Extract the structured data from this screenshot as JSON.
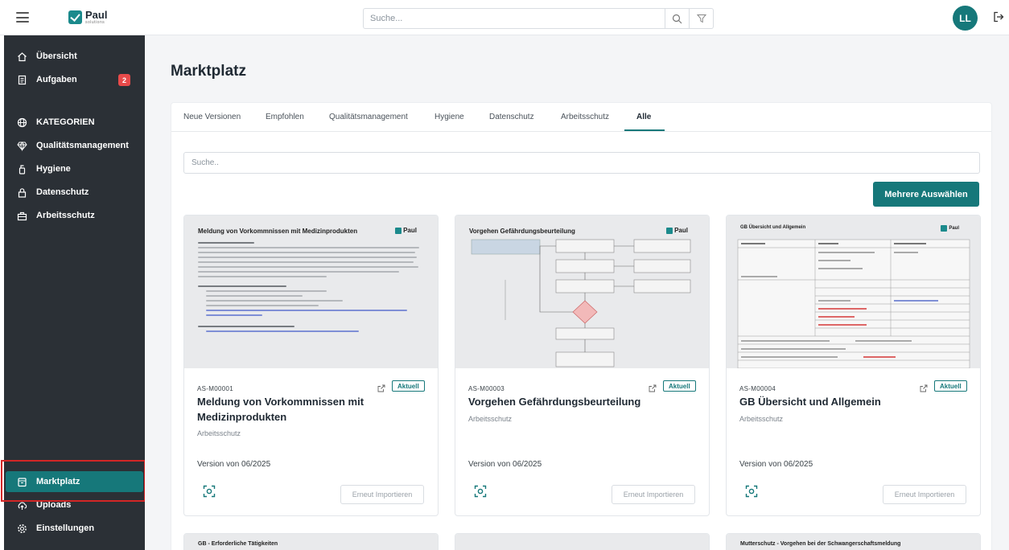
{
  "header": {
    "logo_name": "Paul",
    "logo_sub": "solutions",
    "search_placeholder": "Suche...",
    "user_initials": "LL"
  },
  "sidebar": {
    "items": [
      {
        "label": "Übersicht",
        "icon": "home-icon"
      },
      {
        "label": "Aufgaben",
        "icon": "clipboard-icon",
        "badge": "2"
      },
      {
        "label": "KATEGORIEN",
        "icon": "globe-icon"
      },
      {
        "label": "Qualitätsmanagement",
        "icon": "diamond-icon"
      },
      {
        "label": "Hygiene",
        "icon": "bottle-icon"
      },
      {
        "label": "Datenschutz",
        "icon": "lock-icon"
      },
      {
        "label": "Arbeitsschutz",
        "icon": "toolbox-icon"
      }
    ],
    "bottom_items": [
      {
        "label": "Marktplatz",
        "icon": "store-icon",
        "active": true
      },
      {
        "label": "Uploads",
        "icon": "upload-icon"
      },
      {
        "label": "Einstellungen",
        "icon": "gear-icon"
      }
    ],
    "colors": {
      "background": "#2b3036",
      "active": "#16787a",
      "highlight": "#d32626"
    }
  },
  "main": {
    "title": "Marktplatz",
    "tabs": [
      "Neue Versionen",
      "Empfohlen",
      "Qualitätsmanagement",
      "Hygiene",
      "Datenschutz",
      "Arbeitsschutz",
      "Alle"
    ],
    "active_tab": "Alle",
    "filter_placeholder": "Suche..",
    "multi_select_label": "Mehrere Auswählen",
    "cards": [
      {
        "code": "AS-M00001",
        "title": "Meldung von Vorkommnissen mit Medizinprodukten",
        "category": "Arbeitsschutz",
        "version": "Version von 06/2025",
        "status": "Aktuell",
        "import_label": "Erneut Importieren",
        "thumb_title": "Meldung von Vorkommnissen mit Medizinprodukten",
        "thumb_logo": "Paul"
      },
      {
        "code": "AS-M00003",
        "title": "Vorgehen Gefährdungsbeurteilung",
        "category": "Arbeitsschutz",
        "version": "Version von 06/2025",
        "status": "Aktuell",
        "import_label": "Erneut Importieren",
        "thumb_title": "Vorgehen Gefährdungsbeurteilung",
        "thumb_logo": "Paul"
      },
      {
        "code": "AS-M00004",
        "title": "GB Übersicht und Allgemein",
        "category": "Arbeitsschutz",
        "version": "Version von 06/2025",
        "status": "Aktuell",
        "import_label": "Erneut Importieren",
        "thumb_title": "GB Übersicht und Allgemein",
        "thumb_logo": "Paul"
      }
    ],
    "peek_cards": [
      {
        "thumb_title": "GB - Erforderliche Tätigkeiten"
      },
      {
        "thumb_title": ""
      },
      {
        "thumb_title": "Mutterschutz - Vorgehen bei der Schwangerschaftsmeldung"
      }
    ]
  }
}
